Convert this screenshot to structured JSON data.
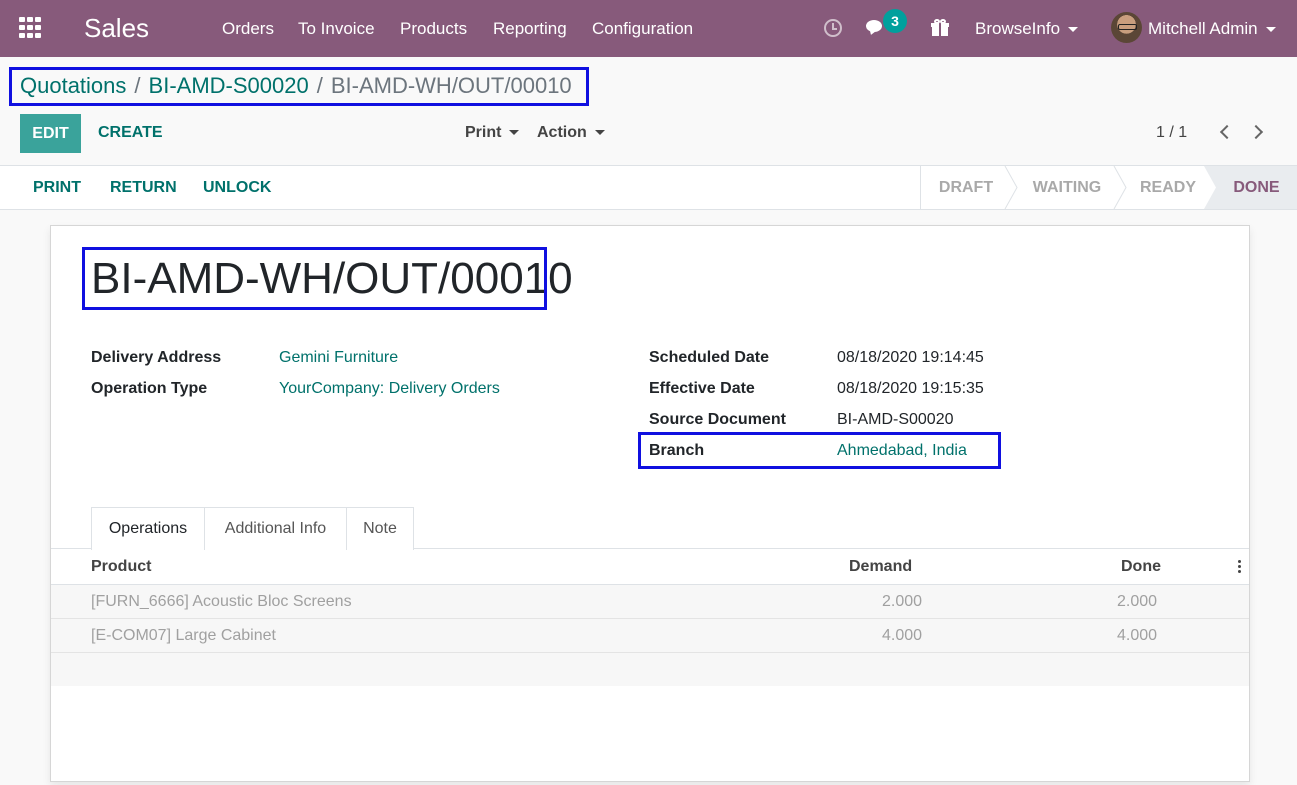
{
  "navbar": {
    "app_name": "Sales",
    "menu": [
      "Orders",
      "To Invoice",
      "Products",
      "Reporting",
      "Configuration"
    ],
    "message_count": "3",
    "company": "BrowseInfo",
    "user": "Mitchell Admin",
    "color": "#875a7b"
  },
  "breadcrumb": {
    "items": [
      "Quotations",
      "BI-AMD-S00020"
    ],
    "separator": "/",
    "current": "BI-AMD-WH/OUT/00010"
  },
  "control": {
    "edit": "EDIT",
    "create": "CREATE",
    "print": "Print",
    "action": "Action",
    "pager": "1 / 1"
  },
  "statusbar": {
    "actions": [
      "PRINT",
      "RETURN",
      "UNLOCK"
    ],
    "stages": [
      "DRAFT",
      "WAITING",
      "READY",
      "DONE"
    ],
    "current_stage": "DONE"
  },
  "record": {
    "name": "BI-AMD-WH/OUT/00010",
    "left_fields": [
      {
        "label": "Delivery Address",
        "value": "Gemini Furniture"
      },
      {
        "label": "Operation Type",
        "value": "YourCompany: Delivery Orders"
      }
    ],
    "right_fields": [
      {
        "label": "Scheduled Date",
        "value": "08/18/2020 19:14:45"
      },
      {
        "label": "Effective Date",
        "value": "08/18/2020 19:15:35"
      },
      {
        "label": "Source Document",
        "value": "BI-AMD-S00020"
      },
      {
        "label": "Branch",
        "value": "Ahmedabad, India"
      }
    ]
  },
  "tabs": [
    "Operations",
    "Additional Info",
    "Note"
  ],
  "table": {
    "headers": [
      "Product",
      "Demand",
      "Done"
    ],
    "rows": [
      [
        "[FURN_6666] Acoustic Bloc Screens",
        "2.000",
        "2.000"
      ],
      [
        "[E-COM07] Large Cabinet",
        "4.000",
        "4.000"
      ]
    ]
  },
  "colors": {
    "accent": "#00716b",
    "primary_button": "#3aa39b",
    "highlight_box": "#1010e0"
  }
}
